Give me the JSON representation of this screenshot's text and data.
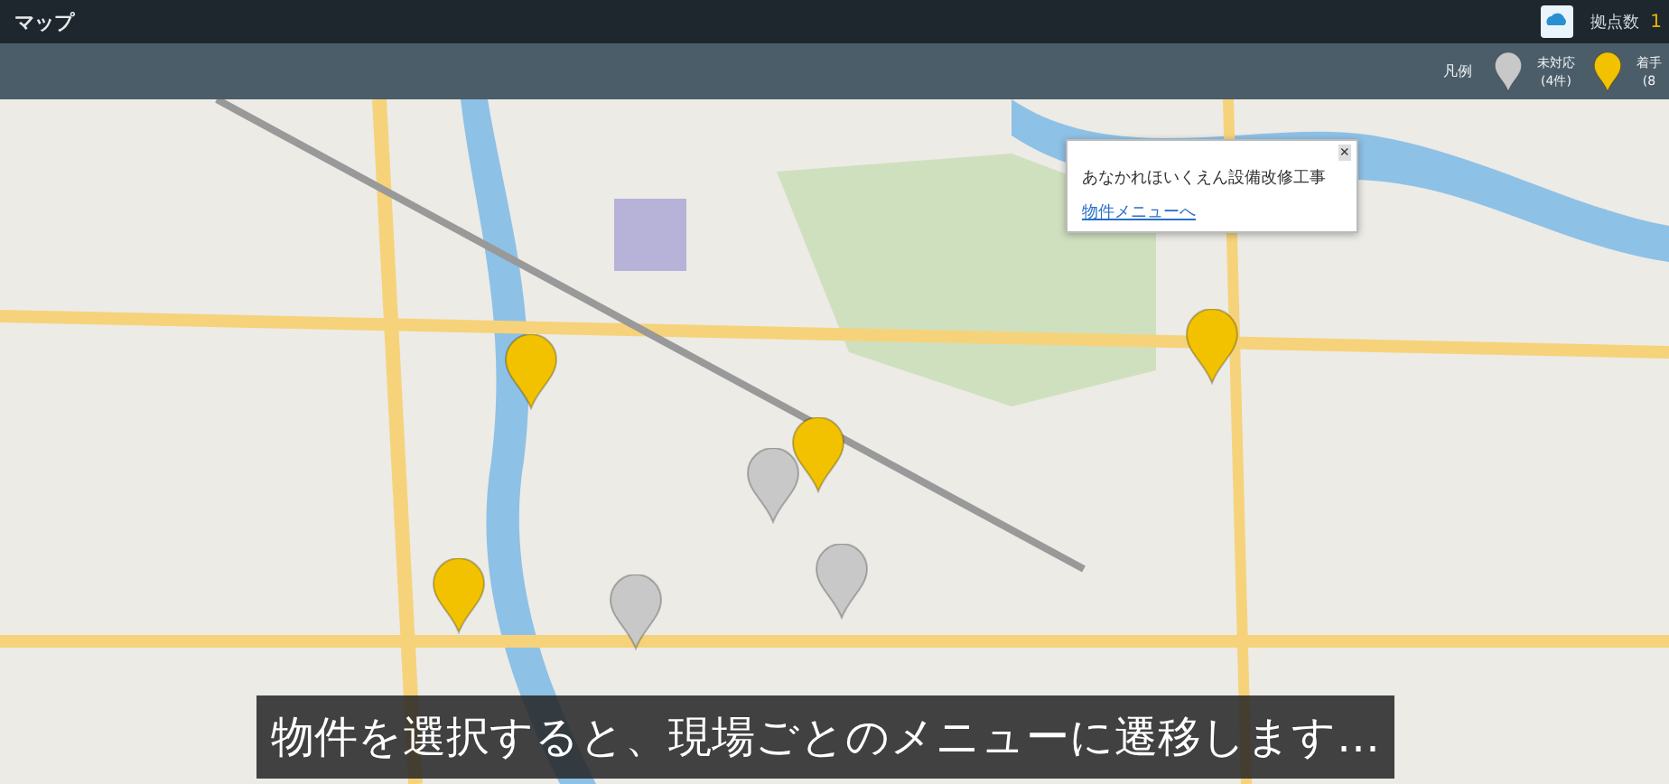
{
  "header": {
    "title": "マップ",
    "count_label": "拠点数",
    "count_value": "1"
  },
  "legend": {
    "label": "凡例",
    "items": [
      {
        "name": "未対応",
        "count": "(4件)",
        "color": "#c8c8c8"
      },
      {
        "name": "着手",
        "count": "(8",
        "color": "#f2c200"
      }
    ]
  },
  "markers": [
    {
      "color": "#f2c200"
    },
    {
      "color": "#f2c200"
    },
    {
      "color": "#f2c200"
    },
    {
      "color": "#f2c200"
    },
    {
      "color": "#c8c8c8"
    },
    {
      "color": "#c8c8c8"
    },
    {
      "color": "#c8c8c8"
    }
  ],
  "popup": {
    "close": "×",
    "title": "あなかれほいくえん設備改修工事",
    "link": "物件メニューへ"
  },
  "caption": "物件を選択すると、現場ごとのメニューに遷移します…"
}
